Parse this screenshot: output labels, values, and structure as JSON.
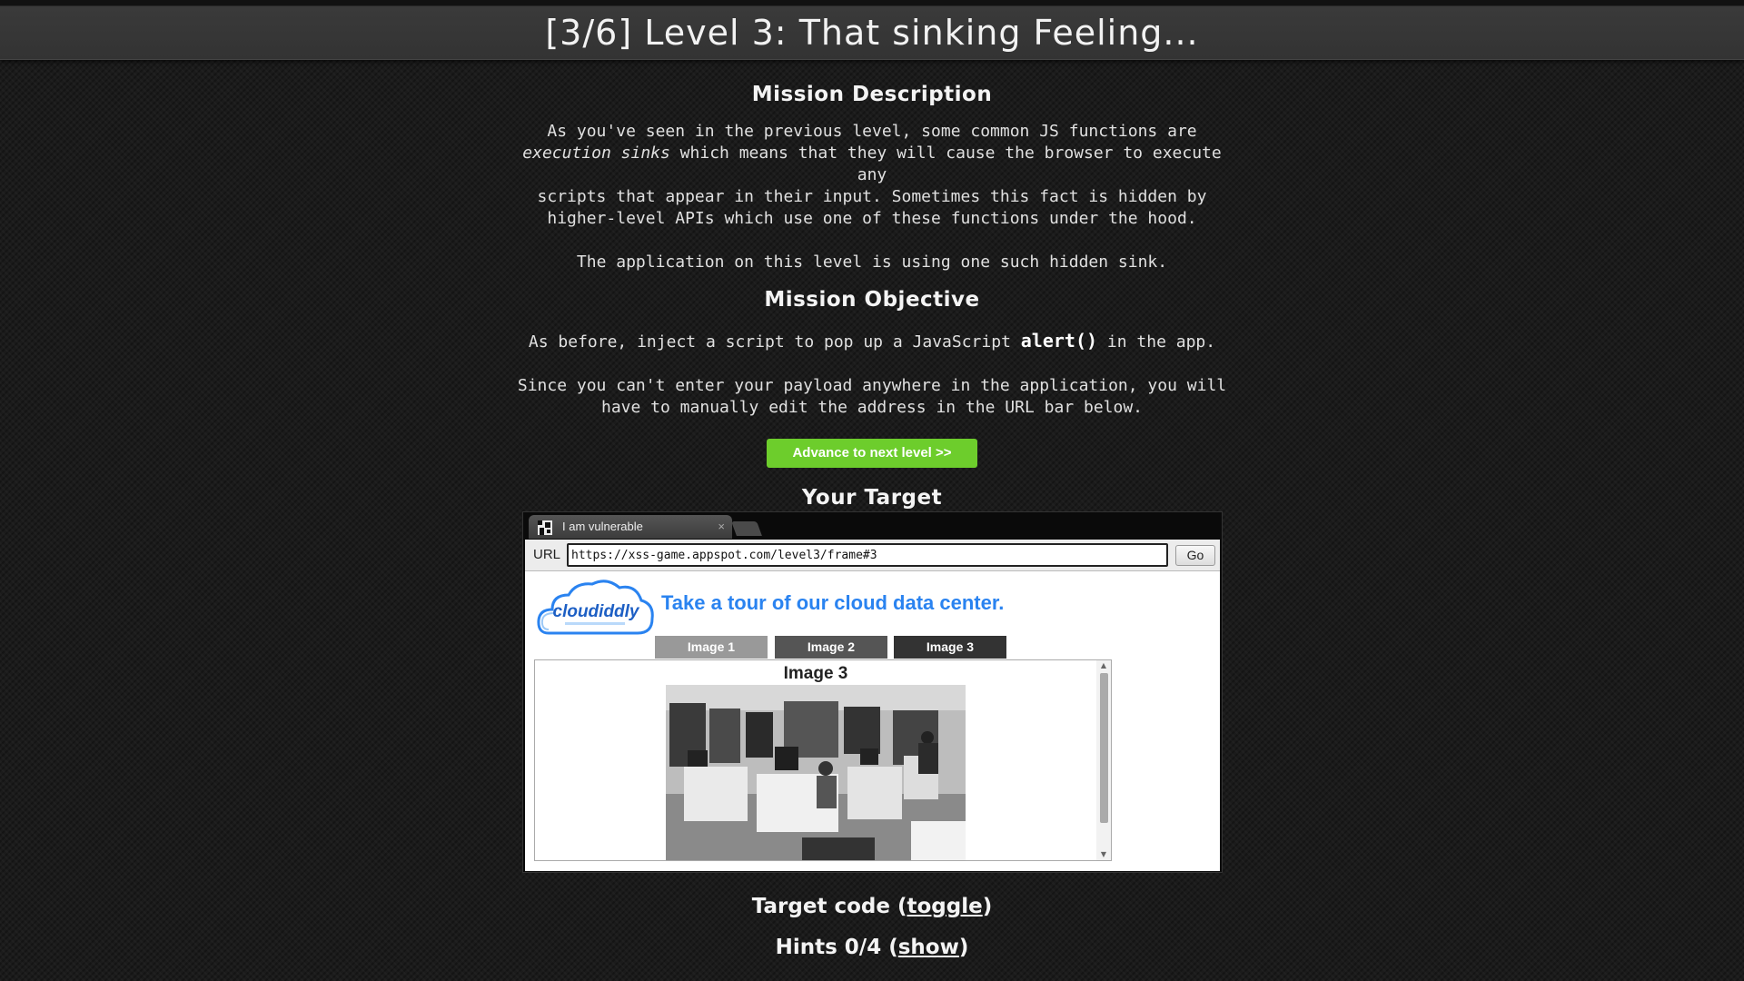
{
  "header": {
    "title": "[3/6]  Level 3: That sinking Feeling..."
  },
  "mission": {
    "heading": "Mission Description",
    "para1_a": "As you've seen in the previous level, some common JS functions are",
    "para1_em": "execution sinks",
    "para1_b": " which means that they will cause the browser to execute any",
    "para1_c": "scripts that appear in their input. Sometimes this fact is hidden by",
    "para1_d": "higher-level APIs which use one of these functions under the hood.",
    "para2": "The application on this level is using one such hidden sink."
  },
  "objective": {
    "heading": "Mission Objective",
    "para1_a": "As before, inject a script to pop up a JavaScript ",
    "para1_code": "alert()",
    "para1_b": " in the app.",
    "para2_a": "Since you can't enter your payload anywhere in the application, you will",
    "para2_b": "have to manually edit the address in the URL bar below."
  },
  "advance_button": "Advance to next level >>",
  "target_heading": "Your Target",
  "browser": {
    "tab_label": "I am vulnerable",
    "tab_close": "×",
    "url_label": "URL",
    "url_value": "https://xss-game.appspot.com/level3/frame#3",
    "go_label": "Go",
    "logo_text": "cloudiddly",
    "tagline": "Take a tour of our cloud data center.",
    "image_tabs": [
      "Image 1",
      "Image 2",
      "Image 3"
    ],
    "active_image_tab": "Image 3",
    "panel_title": "Image 3",
    "scroll_up": "▲",
    "scroll_down": "▼"
  },
  "target_code": {
    "prefix": "Target code (",
    "link": "toggle",
    "suffix": ")"
  },
  "hints": {
    "prefix": "Hints 0/4 (",
    "link": "show",
    "suffix": ")"
  },
  "colors": {
    "advance_button": "#6dcd2c",
    "tagline": "#2a83f0",
    "background": "#1b1b1b"
  }
}
